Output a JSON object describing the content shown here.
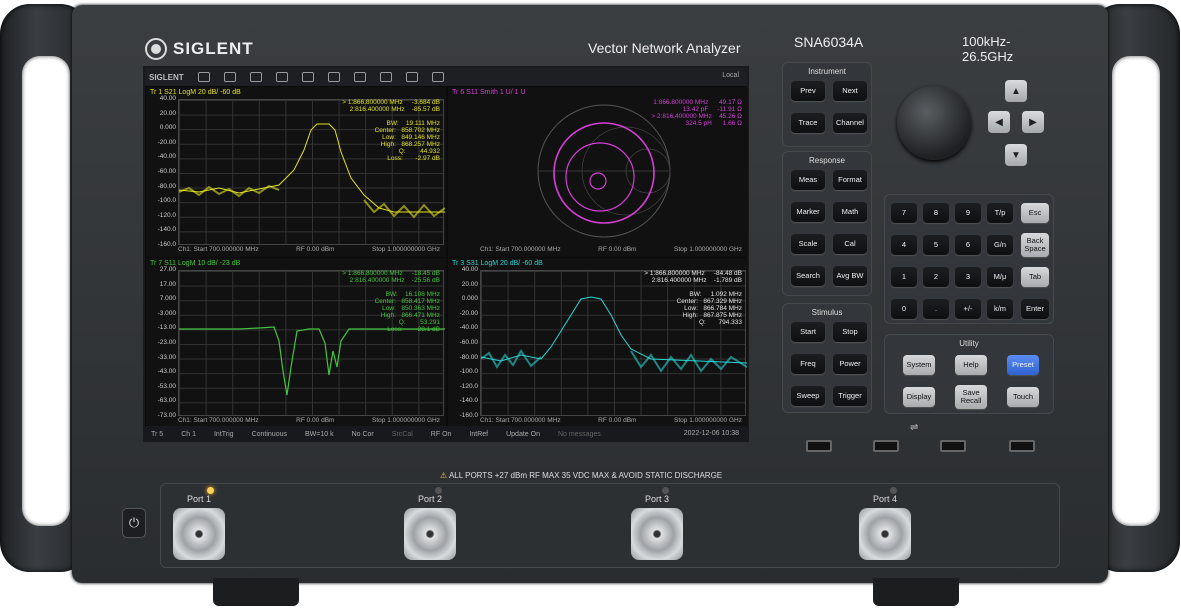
{
  "header": {
    "brand": "SIGLENT",
    "product_name": "Vector Network Analyzer",
    "model": "SNA6034A",
    "freq_range": "100kHz-26.5GHz"
  },
  "toolbar": {
    "brand_small": "SIGLENT",
    "local": "Local"
  },
  "panes": {
    "p1": {
      "header": "Tr 1  S21 LogM 20 dB/ -60 dB",
      "footer_start": "Ch1: Start 700.000000 MHz",
      "footer_rf": "RF 0.00 dBm",
      "footer_stop": "Stop 1.000000000 GHz",
      "num": "2",
      "yticks": [
        "40.00",
        "20.00",
        "0.000",
        "-20.00",
        "-40.00",
        "-60.00",
        "-80.00",
        "-100.0",
        "-120.0",
        "-140.0",
        "-160.0"
      ],
      "markers": "> 1:866.800000 MHz     -3.684 dB\n  2:816.400000 MHz    -85.57 dB\n\n           BW:    19.111 MHz\n       Center:   858.702 MHz\n          Low:   849.146 MHz\n         High:   868.257 MHz\n            Q:        44.932\n         Loss:       -2.97 dB",
      "color": "#e5e21f"
    },
    "p2": {
      "header": "Tr 6  S11 Smith 1 U/ 1 U",
      "footer_start": "Ch1: Start 700.000000 MHz",
      "footer_rf": "RF 0.00 dBm",
      "footer_stop": "Stop 1.000000000 GHz",
      "num": "3",
      "markers": "1:866.800000 MHz      49.17 Ω\n        13.42 pF     -11.91 Ω\n> 2:816.400000 MHz    45.26 Ω\n        324.5 pH      1.66 Ω",
      "color": "#d43fd6"
    },
    "p3": {
      "header": "Tr 7  S11 LogM 10 dB/ -23 dB",
      "footer_start": "Ch1: Start 700.000000 MHz",
      "footer_rf": "RF 0.00 dBm",
      "footer_stop": "Stop 1.000000000 GHz",
      "num": "5",
      "yticks": [
        "27.00",
        "17.00",
        "7.000",
        "-3.000",
        "-13.00",
        "-23.00",
        "-33.00",
        "-43.00",
        "-53.00",
        "-63.00",
        "-73.00"
      ],
      "markers": "> 1:866.800000 MHz     -18.45 dB\n  2:816.400000 MHz    -25.56 dB\n\n           BW:    16.108 MHz\n       Center:   858.417 MHz\n          Low:   850.363 MHz\n         High:   866.471 MHz\n            Q:        53.291\n         Loss:       -28.1 dB",
      "color": "#43c43f"
    },
    "p4": {
      "header": "Tr 3  S31 LogM 20 dB/ -60 dB",
      "footer_start": "Ch1: Start 700.000000 MHz",
      "footer_rf": "RF 0.00 dBm",
      "footer_stop": "Stop 1.000000000 GHz",
      "num": "1",
      "yticks": [
        "40.00",
        "20.00",
        "0.000",
        "-20.00",
        "-40.00",
        "-60.00",
        "-80.00",
        "-100.0",
        "-120.0",
        "-140.0",
        "-160.0"
      ],
      "markers": "> 1:866.800000 MHz     -84.48 dB\n  2:816.400000 MHz    -1.789 dB\n\n           BW:     1.092 MHz\n       Center:   867.329 MHz\n          Low:   866.784 MHz\n         High:   867.875 MHz\n            Q:       794.333",
      "color": "#28d6d6"
    }
  },
  "status": {
    "items": [
      "Tr 5",
      "Ch 1",
      "IntTrig",
      "Continuous",
      "BW=10 k",
      "No Cor",
      "SrcCal",
      "RF On",
      "IntRef",
      "Update On",
      "No messages"
    ],
    "timestamp": "2022-12-06 10:38"
  },
  "panel": {
    "instrument_title": "Instrument",
    "response_title": "Response",
    "stimulus_title": "Stimulus",
    "utility_title": "Utility",
    "keys": {
      "prev": "Prev",
      "next": "Next",
      "trace": "Trace",
      "channel": "Channel",
      "meas": "Meas",
      "format": "Format",
      "marker": "Marker",
      "math": "Math",
      "scale": "Scale",
      "cal": "Cal",
      "search": "Search",
      "avgbw": "Avg BW",
      "start": "Start",
      "stop": "Stop",
      "freq": "Freq",
      "power": "Power",
      "sweep": "Sweep",
      "trigger": "Trigger",
      "system": "System",
      "help": "Help",
      "preset": "Preset",
      "display": "Display",
      "saverecall": "Save Recall",
      "touch": "Touch",
      "k7": "7",
      "k8": "8",
      "k9": "9",
      "tp": "T/p",
      "esc": "Esc",
      "k4": "4",
      "k5": "5",
      "k6": "6",
      "gn": "G/n",
      "backspace": "Back Space",
      "k1": "1",
      "k2": "2",
      "k3": "3",
      "mu": "M/μ",
      "tab": "Tab",
      "k0": "0",
      "dot": ".",
      "pm": "+/-",
      "km": "k/m",
      "enter": "Enter"
    }
  },
  "front": {
    "warning": "ALL PORTS +27 dBm RF MAX 35 VDC MAX  &  AVOID STATIC DISCHARGE",
    "ports": [
      "Port 1",
      "Port 2",
      "Port 3",
      "Port 4"
    ]
  }
}
